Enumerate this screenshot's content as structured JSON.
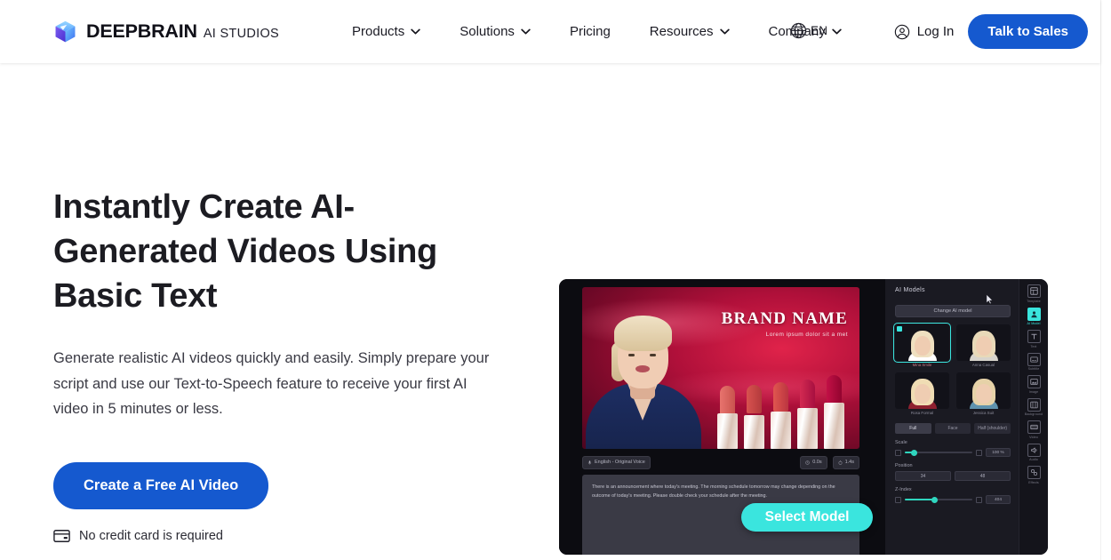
{
  "header": {
    "logo": {
      "icon": "cube-logo-icon",
      "name": "DEEPBRAIN",
      "subname": "AI STUDIOS"
    },
    "nav": [
      {
        "label": "Products",
        "has_chevron": true
      },
      {
        "label": "Solutions",
        "has_chevron": true
      },
      {
        "label": "Pricing",
        "has_chevron": false
      },
      {
        "label": "Resources",
        "has_chevron": true
      },
      {
        "label": "Company",
        "has_chevron": true
      }
    ],
    "language": {
      "icon": "globe-icon",
      "code": "EN"
    },
    "login_label": "Log In",
    "login_icon": "user-circle-icon",
    "cta_label": "Talk to Sales",
    "cta_color": "#1559CF"
  },
  "hero": {
    "title": "Instantly Create AI-Generated Videos Using Basic Text",
    "subtitle": "Generate realistic AI videos quickly and easily. Simply prepare your script and use our Text-to-Speech feature to receive your first AI video in 5 minutes or less.",
    "cta_label": "Create a Free AI Video",
    "cta_color": "#1559CF",
    "note": "No credit card is required",
    "note_icon": "credit-card-icon"
  },
  "editor": {
    "stage": {
      "brand_name": "BRAND NAME",
      "brand_tagline": "Lorem ipsum dolor sit a met",
      "lipstick_colors": [
        "#e8746e",
        "#d8524f",
        "#e0564f",
        "#d32a52",
        "#c21046"
      ]
    },
    "toolbar": {
      "language_chip": "English - Original Voice",
      "language_chip_icon": "mic-icon",
      "chips": [
        {
          "label": "0.0s",
          "icon": "clock-icon"
        },
        {
          "label": "1.4s",
          "icon": "timer-icon"
        }
      ]
    },
    "script_text": "There is an announcement where today's meeting. The morning schedule tomorrow may change depending on the outcome of today's meeting. Please double check your schedule after the meeting.",
    "select_button": "Select Model",
    "select_button_color": "#3AE5DE",
    "panel": {
      "title": "AI Models",
      "change_button": "Change AI model",
      "models": [
        {
          "name": "Mina Smile",
          "selected": true,
          "hair": "#efe0c0",
          "torso": "#ffffff"
        },
        {
          "name": "Anna Casual",
          "selected": false,
          "hair": "#e8d9b8",
          "torso": "#d8d4cc"
        },
        {
          "name": "Rosa Formal",
          "selected": false,
          "hair": "#f0ddb4",
          "torso": "#8e2130"
        },
        {
          "name": "Jessica Suit",
          "selected": false,
          "hair": "#e6d2a8",
          "torso": "#5f93ae"
        }
      ],
      "segments": [
        {
          "label": "Full",
          "active": true
        },
        {
          "label": "Face",
          "active": false
        },
        {
          "label": "Half (shoulder)",
          "active": false
        }
      ],
      "controls": [
        {
          "label": "Scale",
          "value": "100 %",
          "fill_pct": 12
        },
        {
          "label": "Position",
          "x": "34",
          "y": "48"
        },
        {
          "label": "Z-Index",
          "value": "404",
          "fill_pct": 42
        }
      ]
    },
    "rail": [
      {
        "label": "Template",
        "icon": "template-icon",
        "active": false
      },
      {
        "label": "AI Model",
        "icon": "person-icon",
        "active": true
      },
      {
        "label": "Text",
        "icon": "text-icon",
        "active": false
      },
      {
        "label": "Subtitle",
        "icon": "subtitle-icon",
        "active": false
      },
      {
        "label": "Image",
        "icon": "image-icon",
        "active": false
      },
      {
        "label": "Background",
        "icon": "background-icon",
        "active": false
      },
      {
        "label": "Video",
        "icon": "video-icon",
        "active": false
      },
      {
        "label": "Audio",
        "icon": "audio-icon",
        "active": false
      },
      {
        "label": "Effects",
        "icon": "effects-icon",
        "active": false
      }
    ]
  }
}
